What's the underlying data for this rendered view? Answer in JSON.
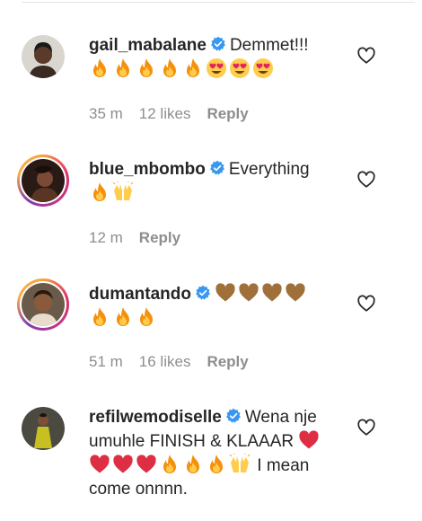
{
  "comments": [
    {
      "username": "gail_mabalane",
      "verified": true,
      "text": "Demmet!!!",
      "emojis_line2": [
        "fire",
        "fire",
        "fire",
        "fire",
        "fire",
        "heart-eyes",
        "heart-eyes",
        "heart-eyes"
      ],
      "time": "35 m",
      "likes": "12 likes",
      "reply": "Reply"
    },
    {
      "username": "blue_mbombo",
      "verified": true,
      "text": "Everything",
      "emojis_line2": [
        "fire",
        "raised-hands"
      ],
      "time": "12 m",
      "likes": "",
      "reply": "Reply"
    },
    {
      "username": "dumantando",
      "verified": true,
      "text": "",
      "emojis_line1": [
        "brown-heart",
        "brown-heart",
        "brown-heart",
        "brown-heart"
      ],
      "emojis_line2": [
        "fire",
        "fire",
        "fire"
      ],
      "time": "51 m",
      "likes": "16 likes",
      "reply": "Reply"
    },
    {
      "username": "refilwemodiselle",
      "verified": true,
      "text_line1": "Wena nje",
      "text_line2": "umuhle FINISH & KLAAAR",
      "text_line3_after": "I mean",
      "text_line4": "come onnnn.",
      "emojis_line2_end": [
        "red-heart"
      ],
      "emojis_line3": [
        "red-heart",
        "red-heart",
        "red-heart",
        "fire",
        "fire",
        "fire",
        "raised-hands"
      ]
    }
  ],
  "colors": {
    "verified": "#3897f0",
    "meta": "#8e8e8e",
    "text": "#262626"
  }
}
